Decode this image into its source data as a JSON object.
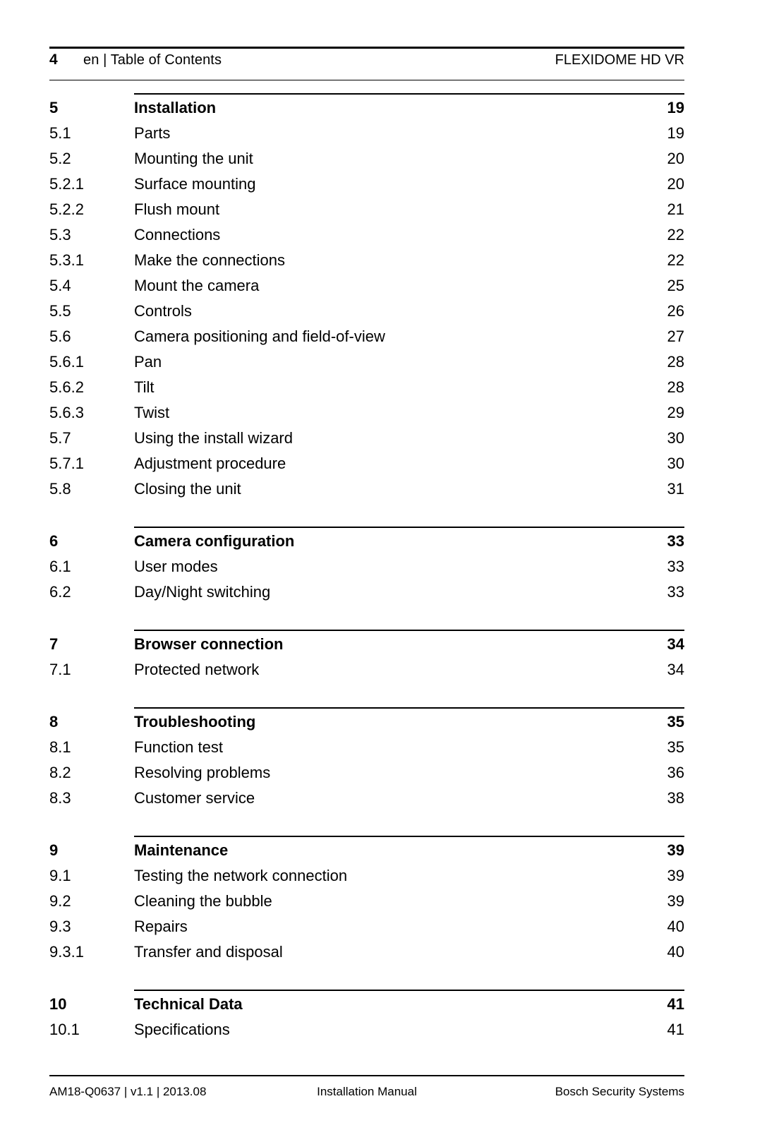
{
  "header": {
    "page_number": "4",
    "left_text": "en | Table of Contents",
    "right_text": "FLEXIDOME HD VR"
  },
  "toc": {
    "blocks": [
      {
        "rows": [
          {
            "level": 1,
            "number": "5",
            "title": "Installation",
            "page": "19"
          },
          {
            "level": 2,
            "number": "5.1",
            "title": "Parts",
            "page": "19"
          },
          {
            "level": 2,
            "number": "5.2",
            "title": "Mounting the unit",
            "page": "20"
          },
          {
            "level": 3,
            "number": "5.2.1",
            "title": "Surface mounting",
            "page": "20"
          },
          {
            "level": 3,
            "number": "5.2.2",
            "title": "Flush mount",
            "page": "21"
          },
          {
            "level": 2,
            "number": "5.3",
            "title": "Connections",
            "page": "22"
          },
          {
            "level": 3,
            "number": "5.3.1",
            "title": "Make the connections",
            "page": "22"
          },
          {
            "level": 2,
            "number": "5.4",
            "title": "Mount the camera",
            "page": "25"
          },
          {
            "level": 2,
            "number": "5.5",
            "title": "Controls",
            "page": "26"
          },
          {
            "level": 2,
            "number": "5.6",
            "title": "Camera positioning and field-of-view",
            "page": "27"
          },
          {
            "level": 3,
            "number": "5.6.1",
            "title": "Pan",
            "page": "28"
          },
          {
            "level": 3,
            "number": "5.6.2",
            "title": "Tilt",
            "page": "28"
          },
          {
            "level": 3,
            "number": "5.6.3",
            "title": "Twist",
            "page": "29"
          },
          {
            "level": 2,
            "number": "5.7",
            "title": "Using the install wizard",
            "page": "30"
          },
          {
            "level": 3,
            "number": "5.7.1",
            "title": "Adjustment procedure",
            "page": "30"
          },
          {
            "level": 2,
            "number": "5.8",
            "title": "Closing the unit",
            "page": "31"
          }
        ]
      },
      {
        "rows": [
          {
            "level": 1,
            "number": "6",
            "title": "Camera configuration",
            "page": "33"
          },
          {
            "level": 2,
            "number": "6.1",
            "title": "User modes",
            "page": "33"
          },
          {
            "level": 2,
            "number": "6.2",
            "title": "Day/Night switching",
            "page": "33"
          }
        ]
      },
      {
        "rows": [
          {
            "level": 1,
            "number": "7",
            "title": "Browser connection",
            "page": "34"
          },
          {
            "level": 2,
            "number": "7.1",
            "title": "Protected network",
            "page": "34"
          }
        ]
      },
      {
        "rows": [
          {
            "level": 1,
            "number": "8",
            "title": "Troubleshooting",
            "page": "35"
          },
          {
            "level": 2,
            "number": "8.1",
            "title": "Function test",
            "page": "35"
          },
          {
            "level": 2,
            "number": "8.2",
            "title": "Resolving problems",
            "page": "36"
          },
          {
            "level": 2,
            "number": "8.3",
            "title": "Customer service",
            "page": "38"
          }
        ]
      },
      {
        "rows": [
          {
            "level": 1,
            "number": "9",
            "title": "Maintenance",
            "page": "39"
          },
          {
            "level": 2,
            "number": "9.1",
            "title": "Testing the network connection",
            "page": "39"
          },
          {
            "level": 2,
            "number": "9.2",
            "title": "Cleaning the bubble",
            "page": "39"
          },
          {
            "level": 2,
            "number": "9.3",
            "title": "Repairs",
            "page": "40"
          },
          {
            "level": 3,
            "number": "9.3.1",
            "title": "Transfer and disposal",
            "page": "40"
          }
        ]
      },
      {
        "rows": [
          {
            "level": 1,
            "number": "10",
            "title": "Technical Data",
            "page": "41"
          },
          {
            "level": 2,
            "number": "10.1",
            "title": "Specifications",
            "page": "41"
          }
        ]
      }
    ]
  },
  "footer": {
    "left_text": "AM18-Q0637 | v1.1 | 2013.08",
    "center_text": "Installation Manual",
    "right_text": "Bosch Security Systems"
  }
}
